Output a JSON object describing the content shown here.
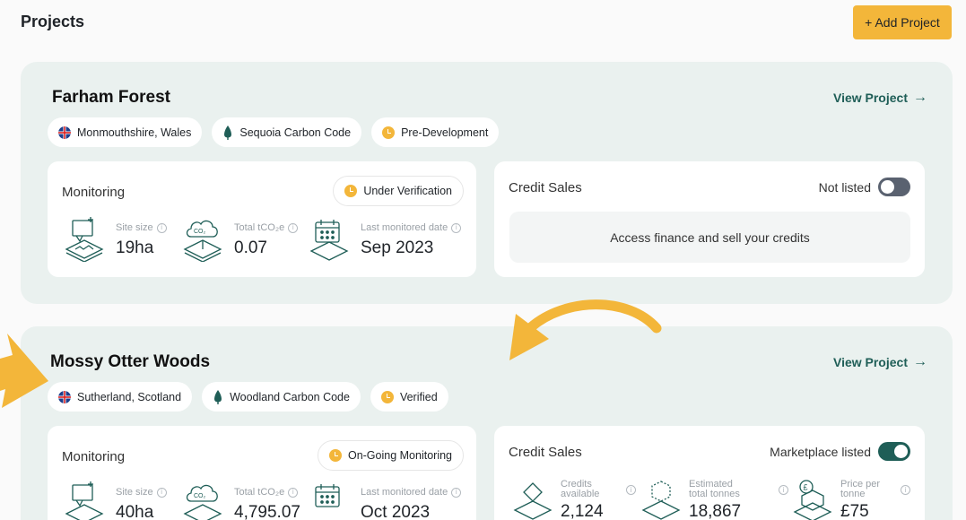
{
  "header": {
    "title": "Projects",
    "add_button": "+ Add Project"
  },
  "colors": {
    "accent": "#f3b63a",
    "brand_green": "#1f5e57",
    "card_bg": "#eaf1ef"
  },
  "projects": [
    {
      "name": "Farham Forest",
      "view_link": "View Project",
      "chips": [
        "Monmouthshire, Wales",
        "Sequoia Carbon Code",
        "Pre-Development"
      ],
      "monitoring": {
        "title": "Monitoring",
        "status": "Under Verification",
        "stats": [
          {
            "label": "Site size",
            "value": "19ha",
            "icon": "map-pin-terrain-icon"
          },
          {
            "label": "Total tCO₂e",
            "value": "0.07",
            "icon": "co2-cloud-icon"
          },
          {
            "label": "Last monitored date",
            "value": "Sep 2023",
            "icon": "calendar-icon"
          }
        ]
      },
      "credit_sales": {
        "title": "Credit Sales",
        "listed_label": "Not listed",
        "listed": false,
        "message": "Access finance and sell your credits"
      }
    },
    {
      "name": "Mossy Otter Woods",
      "view_link": "View Project",
      "chips": [
        "Sutherland, Scotland",
        "Woodland Carbon Code",
        "Verified"
      ],
      "monitoring": {
        "title": "Monitoring",
        "status": "On-Going Monitoring",
        "stats": [
          {
            "label": "Site size",
            "value": "40ha",
            "icon": "map-pin-terrain-icon"
          },
          {
            "label": "Total tCO₂e",
            "value": "4,795.07",
            "icon": "co2-cloud-icon"
          },
          {
            "label": "Last monitored date",
            "value": "Oct 2023",
            "icon": "calendar-icon"
          }
        ]
      },
      "credit_sales": {
        "title": "Credit Sales",
        "listed_label": "Marketplace listed",
        "listed": true,
        "stats": [
          {
            "label": "Credits available",
            "value": "2,124",
            "icon": "credit-diamond-icon"
          },
          {
            "label": "Estimated total tonnes",
            "value": "18,867",
            "icon": "cube-stack-icon"
          },
          {
            "label": "Price per tonne",
            "value": "£75",
            "icon": "price-box-icon"
          }
        ]
      }
    }
  ]
}
